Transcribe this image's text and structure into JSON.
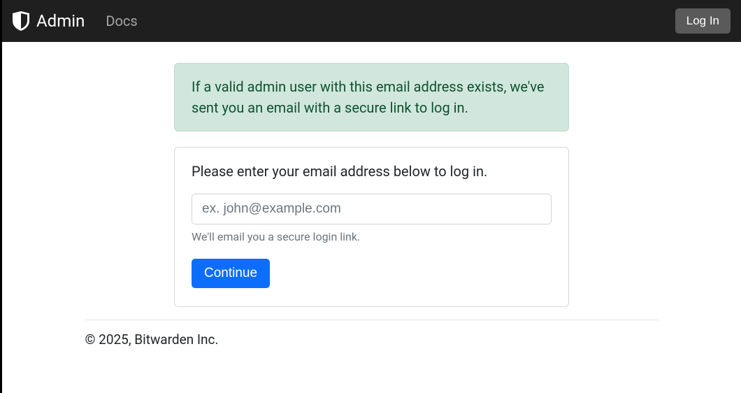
{
  "navbar": {
    "brand": "Admin",
    "docs_link": "Docs",
    "login_button": "Log In"
  },
  "alert": {
    "message": "If a valid admin user with this email address exists, we've sent you an email with a secure link to log in."
  },
  "login_card": {
    "title": "Please enter your email address below to log in.",
    "email_placeholder": "ex. john@example.com",
    "help_text": "We'll email you a secure login link.",
    "continue_button": "Continue"
  },
  "footer": {
    "copyright": "© 2025, Bitwarden Inc."
  }
}
